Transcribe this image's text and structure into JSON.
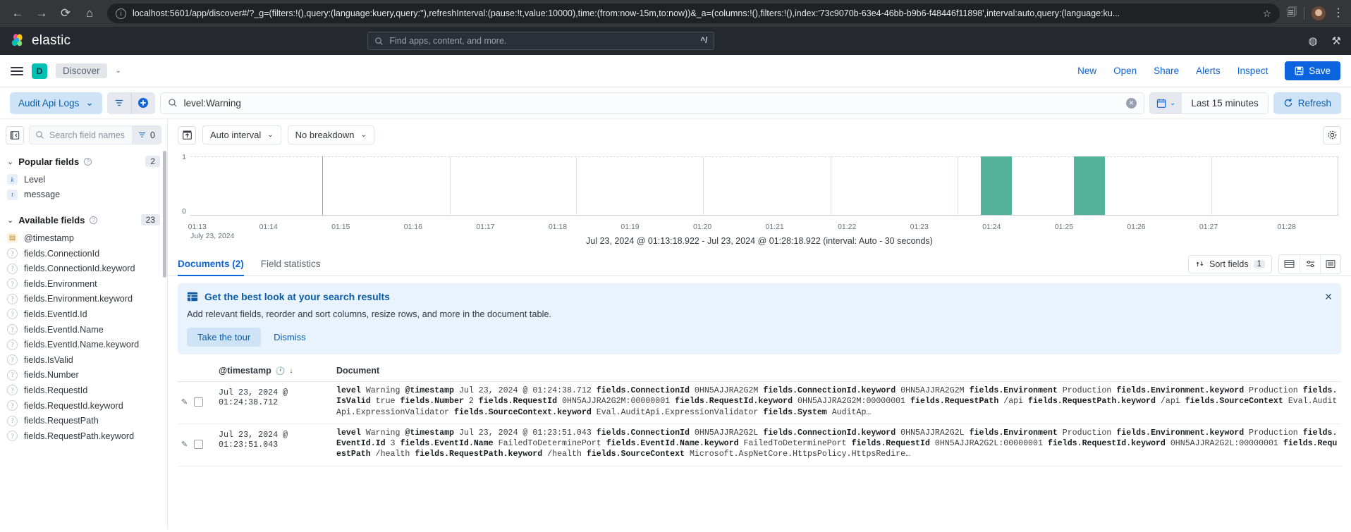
{
  "browser": {
    "url": "localhost:5601/app/discover#/?_g=(filters:!(),query:(language:kuery,query:''),refreshInterval:(pause:!t,value:10000),time:(from:now-15m,to:now))&_a=(columns:!(),filters:!(),index:'73c9070b-63e4-46bb-b9b6-f48446f11898',interval:auto,query:(language:ku...",
    "back_icon": "back-arrow-icon",
    "forward_icon": "forward-arrow-icon",
    "reload_icon": "reload-icon",
    "home_icon": "home-icon",
    "info_icon": "info-icon",
    "star_icon": "bookmark-star-icon"
  },
  "elastic_nav": {
    "brand": "elastic",
    "search_placeholder": "Find apps, content, and more.",
    "search_shortcut": "^/"
  },
  "app_header": {
    "space_initial": "D",
    "breadcrumb": "Discover",
    "links": [
      "New",
      "Open",
      "Share",
      "Alerts",
      "Inspect"
    ],
    "save_label": "Save"
  },
  "query_bar": {
    "data_view": "Audit Api Logs",
    "query": "level:Warning",
    "time_range": "Last 15 minutes",
    "refresh_label": "Refresh"
  },
  "sidebar": {
    "search_placeholder": "Search field names",
    "filter_count": "0",
    "popular": {
      "title": "Popular fields",
      "count": "2",
      "fields": [
        {
          "name": "Level",
          "type": "k"
        },
        {
          "name": "message",
          "type": "t"
        }
      ]
    },
    "available": {
      "title": "Available fields",
      "count": "23",
      "fields": [
        {
          "name": "@timestamp",
          "type": "date"
        },
        {
          "name": "fields.ConnectionId",
          "type": "unknown"
        },
        {
          "name": "fields.ConnectionId.keyword",
          "type": "unknown"
        },
        {
          "name": "fields.Environment",
          "type": "unknown"
        },
        {
          "name": "fields.Environment.keyword",
          "type": "unknown"
        },
        {
          "name": "fields.EventId.Id",
          "type": "unknown"
        },
        {
          "name": "fields.EventId.Name",
          "type": "unknown"
        },
        {
          "name": "fields.EventId.Name.keyword",
          "type": "unknown"
        },
        {
          "name": "fields.IsValid",
          "type": "unknown"
        },
        {
          "name": "fields.Number",
          "type": "unknown"
        },
        {
          "name": "fields.RequestId",
          "type": "unknown"
        },
        {
          "name": "fields.RequestId.keyword",
          "type": "unknown"
        },
        {
          "name": "fields.RequestPath",
          "type": "unknown"
        },
        {
          "name": "fields.RequestPath.keyword",
          "type": "unknown"
        }
      ]
    }
  },
  "chart_toolbar": {
    "interval": "Auto interval",
    "breakdown": "No breakdown"
  },
  "chart_data": {
    "type": "bar",
    "title": "",
    "xlabel": "",
    "ylabel": "",
    "ylim": [
      0,
      1
    ],
    "ytick_labels": [
      "0",
      "1"
    ],
    "categories": [
      "01:13",
      "01:14",
      "01:15",
      "01:16",
      "01:17",
      "01:18",
      "01:19",
      "01:20",
      "01:21",
      "01:22",
      "01:23",
      "01:24",
      "01:25",
      "01:26",
      "01:27",
      "01:28"
    ],
    "xaxis_subtitle": "July 23, 2024",
    "values": [
      0,
      0,
      0,
      0,
      0,
      0,
      0,
      0,
      0,
      0,
      1,
      0,
      1,
      0,
      0,
      0
    ],
    "bars": [
      {
        "time": "01:23:30",
        "value": 1
      },
      {
        "time": "01:24:30",
        "value": 1
      }
    ],
    "bar_color": "#54b399",
    "grid": true,
    "legend": "none",
    "range_caption": "Jul 23, 2024 @ 01:13:18.922 - Jul 23, 2024 @ 01:28:18.922 (interval: Auto - 30 seconds)"
  },
  "tabs": {
    "documents": "Documents (2)",
    "field_stats": "Field statistics",
    "sort_fields_label": "Sort fields",
    "sort_fields_count": "1"
  },
  "callout": {
    "title": "Get the best look at your search results",
    "body": "Add relevant fields, reorder and sort columns, resize rows, and more in the document table.",
    "primary": "Take the tour",
    "secondary": "Dismiss"
  },
  "doc_table": {
    "col_timestamp": "@timestamp",
    "col_document": "Document",
    "rows": [
      {
        "timestamp": "Jul 23, 2024 @ 01:24:38.712",
        "pairs": [
          [
            "level",
            "Warning"
          ],
          [
            "@timestamp",
            "Jul 23, 2024 @ 01:24:38.712"
          ],
          [
            "fields.ConnectionId",
            "0HN5AJJRA2G2M"
          ],
          [
            "fields.ConnectionId.keyword",
            "0HN5AJJRA2G2M"
          ],
          [
            "fields.Environment",
            "Production"
          ],
          [
            "fields.Environment.keyword",
            "Production"
          ],
          [
            "fields.IsValid",
            "true"
          ],
          [
            "fields.Number",
            "2"
          ],
          [
            "fields.RequestId",
            "0HN5AJJRA2G2M:00000001"
          ],
          [
            "fields.RequestId.keyword",
            "0HN5AJJRA2G2M:00000001"
          ],
          [
            "fields.RequestPath",
            "/api"
          ],
          [
            "fields.RequestPath.keyword",
            "/api"
          ],
          [
            "fields.SourceContext",
            "Eval.AuditApi.ExpressionValidator"
          ],
          [
            "fields.SourceContext.keyword",
            "Eval.AuditApi.ExpressionValidator"
          ],
          [
            "fields.System",
            "AuditAp…"
          ]
        ]
      },
      {
        "timestamp": "Jul 23, 2024 @ 01:23:51.043",
        "pairs": [
          [
            "level",
            "Warning"
          ],
          [
            "@timestamp",
            "Jul 23, 2024 @ 01:23:51.043"
          ],
          [
            "fields.ConnectionId",
            "0HN5AJJRA2G2L"
          ],
          [
            "fields.ConnectionId.keyword",
            "0HN5AJJRA2G2L"
          ],
          [
            "fields.Environment",
            "Production"
          ],
          [
            "fields.Environment.keyword",
            "Production"
          ],
          [
            "fields.EventId.Id",
            "3"
          ],
          [
            "fields.EventId.Name",
            "FailedToDeterminePort"
          ],
          [
            "fields.EventId.Name.keyword",
            "FailedToDeterminePort"
          ],
          [
            "fields.RequestId",
            "0HN5AJJRA2G2L:00000001"
          ],
          [
            "fields.RequestId.keyword",
            "0HN5AJJRA2G2L:00000001"
          ],
          [
            "fields.RequestPath",
            "/health"
          ],
          [
            "fields.RequestPath.keyword",
            "/health"
          ],
          [
            "fields.SourceContext",
            "Microsoft.AspNetCore.HttpsPolicy.HttpsRedire…"
          ]
        ]
      }
    ]
  }
}
